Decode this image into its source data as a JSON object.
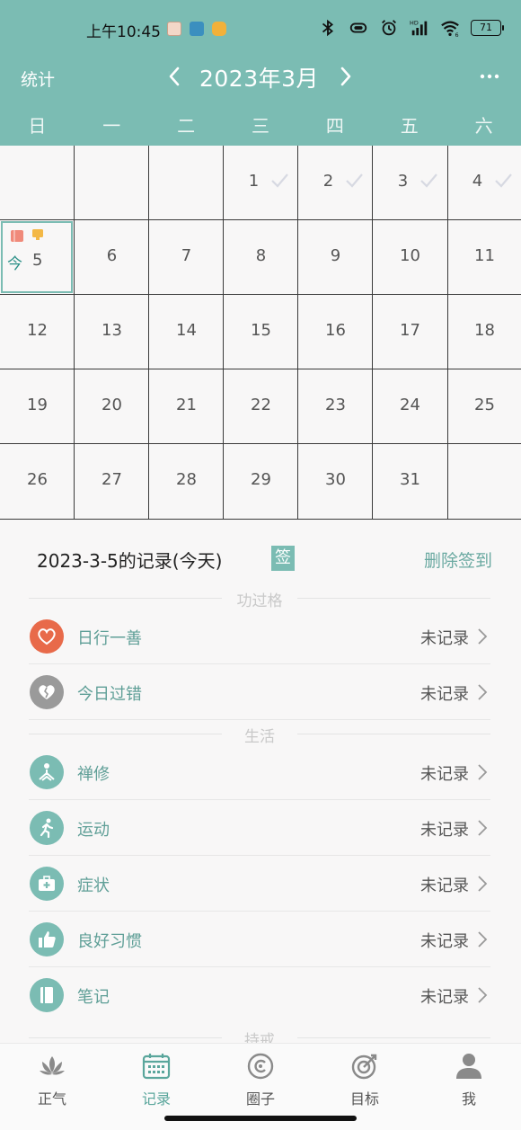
{
  "status_bar": {
    "time": "上午10:45",
    "battery": "71",
    "network_badge": "HD",
    "wifi_badge": "6"
  },
  "nav": {
    "left_label": "统计",
    "month_title": "2023年3月",
    "prev_icon": "chevron-left-icon",
    "next_icon": "chevron-right-icon",
    "more_icon": "more-dots-icon"
  },
  "weekdays": [
    "日",
    "一",
    "二",
    "三",
    "四",
    "五",
    "六"
  ],
  "calendar": {
    "week1": [
      "1",
      "2",
      "3",
      "4"
    ],
    "today": {
      "tag": "今",
      "day": "5"
    },
    "week2": [
      "6",
      "7",
      "8",
      "9",
      "10",
      "11"
    ],
    "week3": [
      "12",
      "13",
      "14",
      "15",
      "16",
      "17",
      "18"
    ],
    "week4": [
      "19",
      "20",
      "21",
      "22",
      "23",
      "24",
      "25"
    ],
    "week5": [
      "26",
      "27",
      "28",
      "29",
      "30",
      "31"
    ]
  },
  "record": {
    "title": "2023-3-5的记录(今天)",
    "sign_badge": "签",
    "delete_sign": "删除签到"
  },
  "sections": {
    "merit": "功过格",
    "life": "生活",
    "precepts": "持戒"
  },
  "items": {
    "good_deed": {
      "label": "日行一善",
      "status": "未记录",
      "color": "#e86a4a"
    },
    "mistake": {
      "label": "今日过错",
      "status": "未记录",
      "color": "#9a9a9a"
    },
    "meditation": {
      "label": "禅修",
      "status": "未记录",
      "color": "#7bbcb3"
    },
    "exercise": {
      "label": "运动",
      "status": "未记录",
      "color": "#7bbcb3"
    },
    "symptom": {
      "label": "症状",
      "status": "未记录",
      "color": "#7bbcb3"
    },
    "habit": {
      "label": "良好习惯",
      "status": "未记录",
      "color": "#7bbcb3"
    },
    "note": {
      "label": "笔记",
      "status": "未记录",
      "color": "#7bbcb3"
    }
  },
  "tabs": {
    "zhengqi": "正气",
    "record": "记录",
    "circle": "圈子",
    "goal": "目标",
    "me": "我"
  },
  "colors": {
    "accent": "#7bbcb3",
    "accent_text": "#5f9f97"
  }
}
